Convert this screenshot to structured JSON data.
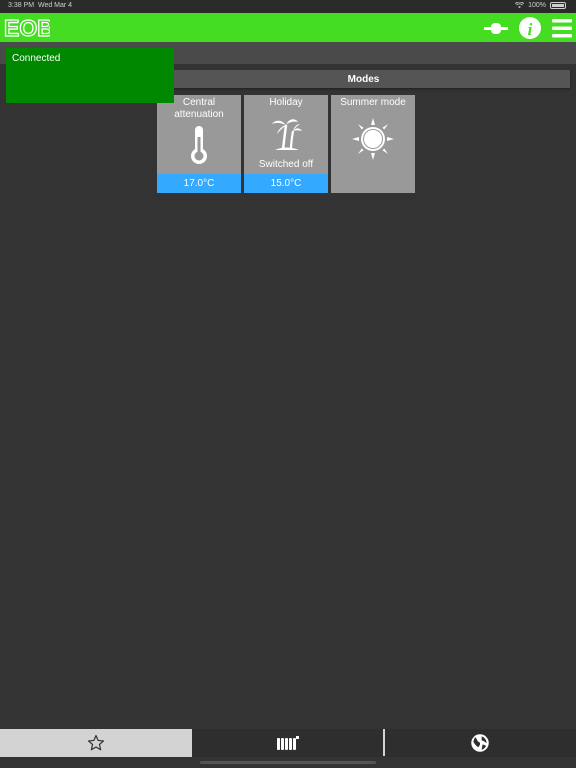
{
  "status_bar": {
    "time": "3:38 PM",
    "date": "Wed Mar 4",
    "battery": "100%"
  },
  "header": {
    "logo_text": "EOB",
    "brand_color": "#44dd22"
  },
  "toast": {
    "text": "Connected",
    "color": "#008800"
  },
  "modes": {
    "title": "Modes",
    "tiles": [
      {
        "title": "Central attenuation",
        "icon": "thermometer-icon",
        "value": "17.0°C"
      },
      {
        "title": "Holiday",
        "icon": "palm-trees-icon",
        "status": "Switched off",
        "value": "15.0°C"
      },
      {
        "title": "Summer mode",
        "icon": "sun-icon"
      }
    ]
  },
  "bottom_nav": {
    "tabs": [
      {
        "icon": "star-icon",
        "active": true
      },
      {
        "icon": "radiator-icon",
        "active": false
      },
      {
        "icon": "globe-icon",
        "active": false
      }
    ]
  }
}
